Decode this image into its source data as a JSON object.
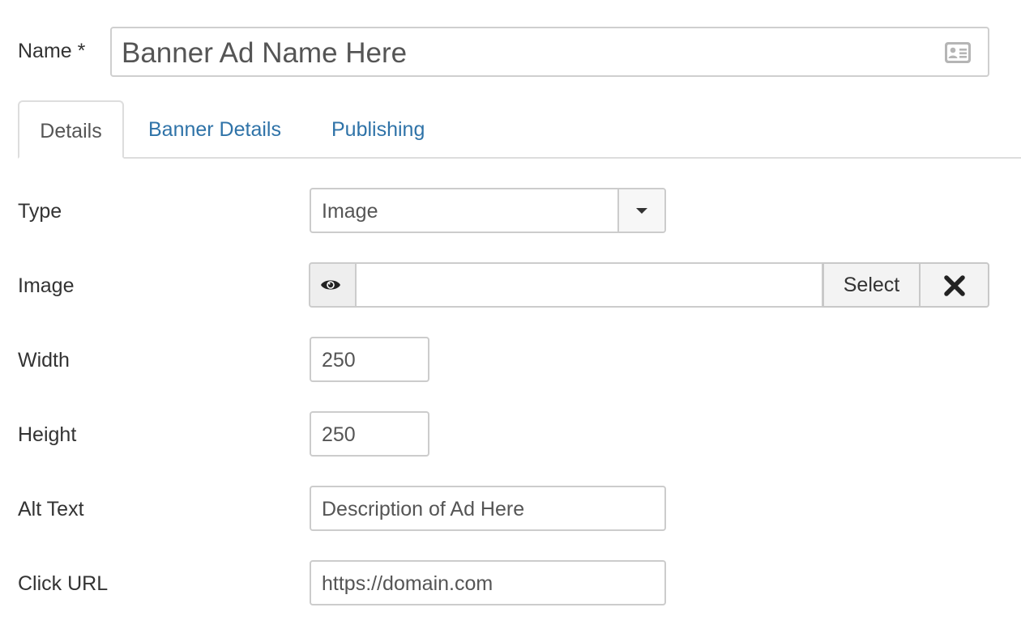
{
  "name_field": {
    "label": "Name *",
    "value": "Banner Ad Name Here",
    "icon": "contact-card-icon"
  },
  "tabs": [
    {
      "label": "Details",
      "active": true
    },
    {
      "label": "Banner Details",
      "active": false
    },
    {
      "label": "Publishing",
      "active": false
    }
  ],
  "form": {
    "type": {
      "label": "Type",
      "selected": "Image"
    },
    "image": {
      "label": "Image",
      "value": "",
      "preview_icon": "eye-icon",
      "select_label": "Select",
      "clear_icon": "close-icon"
    },
    "width": {
      "label": "Width",
      "value": "250"
    },
    "height": {
      "label": "Height",
      "value": "250"
    },
    "alt_text": {
      "label": "Alt Text",
      "value": "Description of Ad Here"
    },
    "click_url": {
      "label": "Click URL",
      "value": "https://domain.com"
    }
  },
  "colors": {
    "link": "#2f73a8",
    "border": "#cccccc",
    "text": "#333333"
  }
}
